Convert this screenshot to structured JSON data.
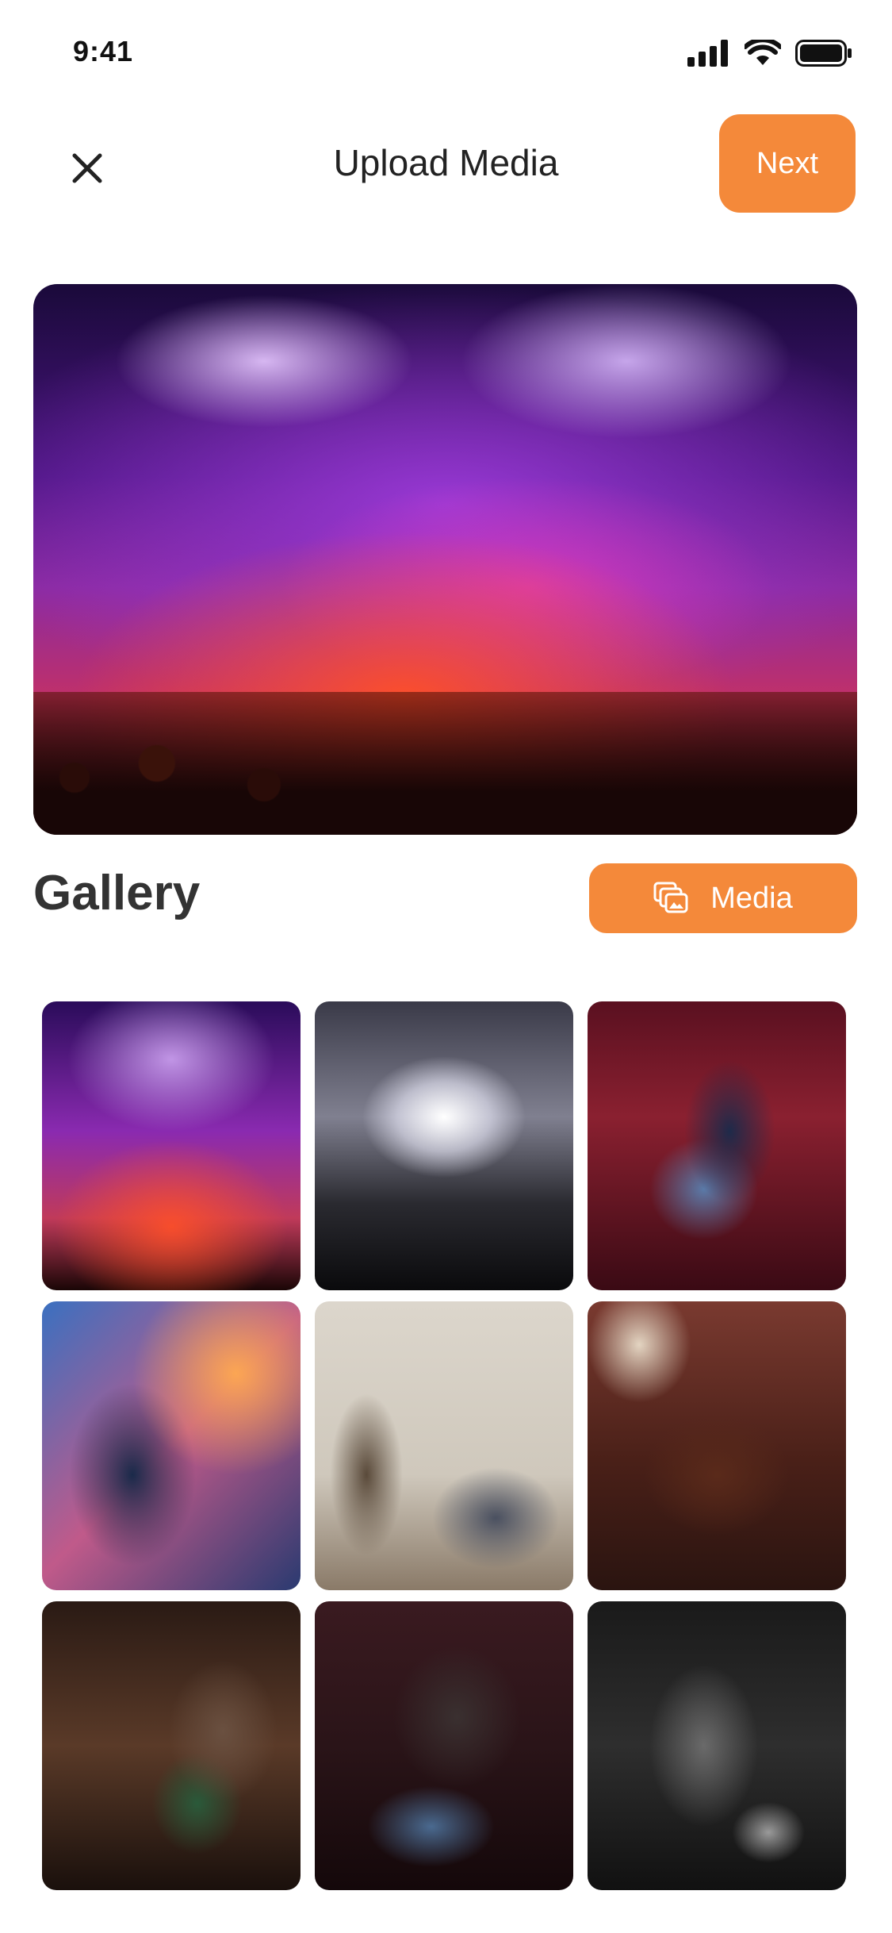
{
  "status_bar": {
    "time": "9:41",
    "icons": [
      "cellular-signal-icon",
      "wifi-icon",
      "battery-icon"
    ]
  },
  "header": {
    "title": "Upload Media",
    "next_label": "Next",
    "close_icon": "close-icon"
  },
  "hero": {
    "image": "concert-stage-crowd-purple-lights"
  },
  "gallery": {
    "title": "Gallery",
    "media_button_label": "Media",
    "media_button_icon": "media-stack-icon",
    "items": [
      {
        "image": "concert-purple-lights"
      },
      {
        "image": "concert-white-burst"
      },
      {
        "image": "guitarist-red-stage"
      },
      {
        "image": "singer-microphone-warm-light"
      },
      {
        "image": "acoustic-living-room-session"
      },
      {
        "image": "band-cozy-room"
      },
      {
        "image": "singer-guitar-band"
      },
      {
        "image": "singer-guitar-dark-stage"
      },
      {
        "image": "guitarist-monochrome"
      }
    ]
  },
  "colors": {
    "accent": "#F4893A",
    "text": "#222222",
    "background": "#FFFFFF"
  }
}
